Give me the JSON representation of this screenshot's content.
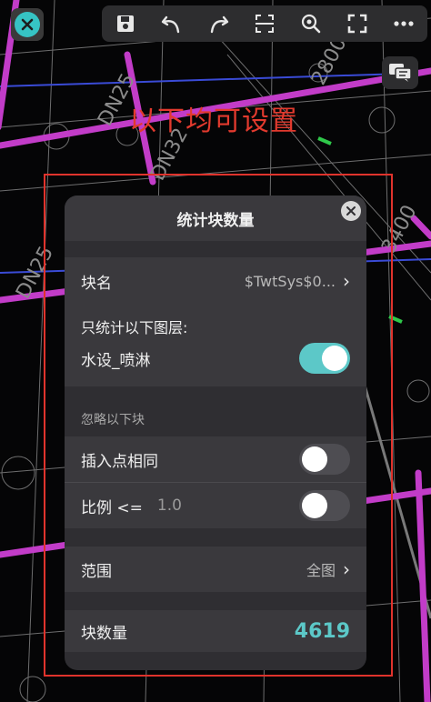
{
  "toolbar": {
    "close_icon": "close-icon",
    "icons": [
      "save-icon",
      "undo-icon",
      "redo-icon",
      "fit-view-icon",
      "zoom-icon",
      "fullscreen-icon",
      "more-icon"
    ],
    "comment_icon": "comment-icon"
  },
  "cad_labels": [
    "DN25",
    "DN25",
    "DN32",
    "2800",
    "3400"
  ],
  "annotation": {
    "text": "以下均可设置",
    "color": "#e23a2e"
  },
  "dialog": {
    "title": "统计块数量",
    "block_name": {
      "label": "块名",
      "value": "$TwtSys$0..."
    },
    "layers": {
      "caption": "只统计以下图层:",
      "layer_name": "水设_喷淋",
      "enabled": true
    },
    "ignore": {
      "caption": "忽略以下块",
      "same_insert": {
        "label": "插入点相同",
        "enabled": false
      },
      "ratio": {
        "label": "比例 <=",
        "value": "1.0",
        "enabled": false
      }
    },
    "range": {
      "label": "范围",
      "value": "全图"
    },
    "count": {
      "label": "块数量",
      "value": "4619"
    }
  },
  "colors": {
    "accent": "#5cc8c8",
    "pipe": "#c23cc8",
    "annotation": "#e0332c"
  }
}
